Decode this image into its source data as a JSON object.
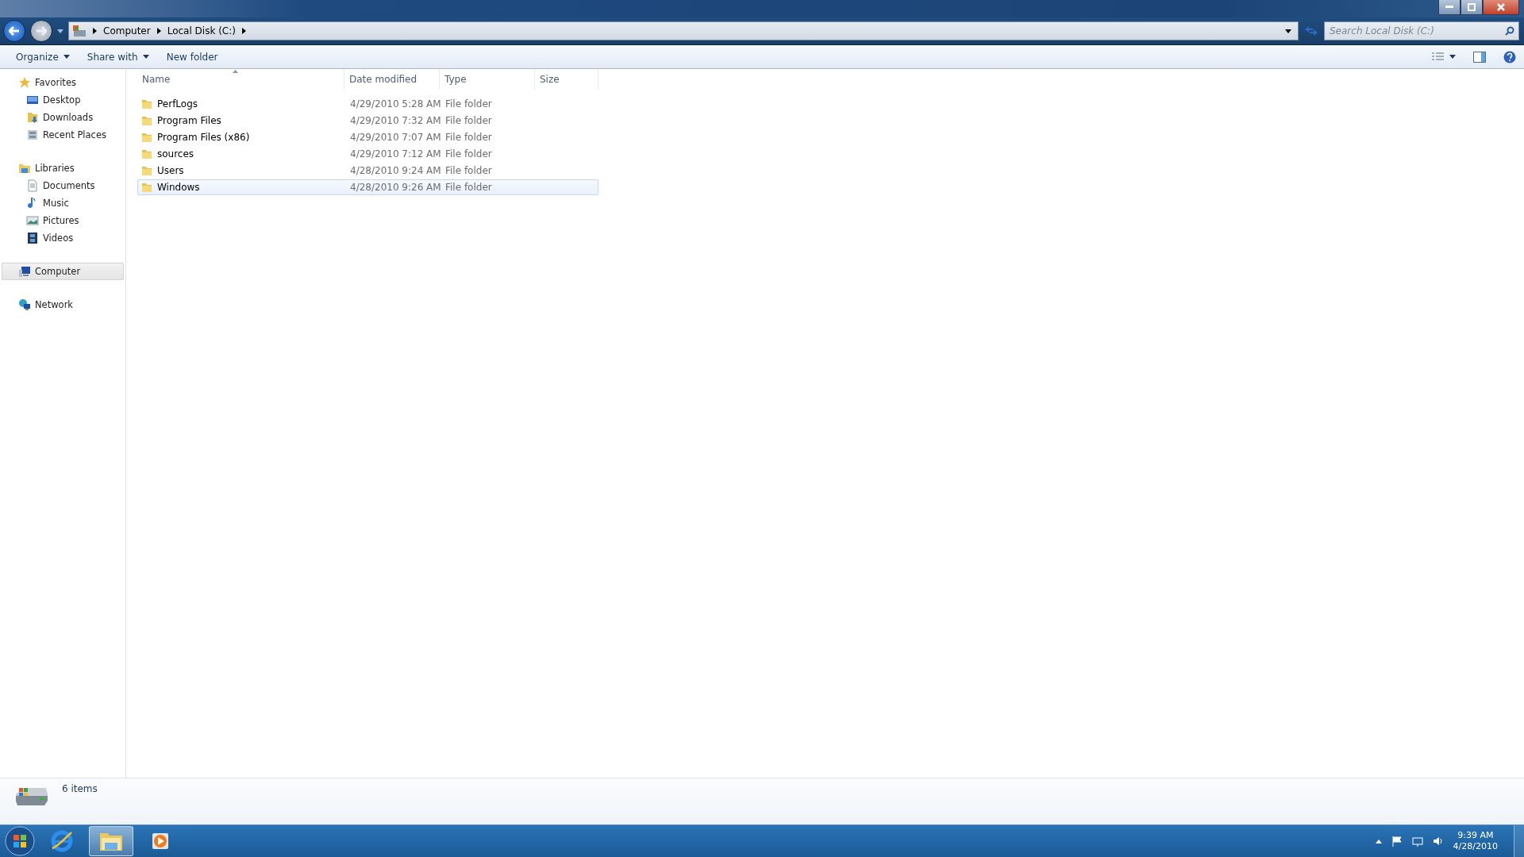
{
  "address_bar": {
    "breadcrumbs": [
      "Computer",
      "Local Disk (C:)"
    ]
  },
  "search": {
    "placeholder": "Search Local Disk (C:)"
  },
  "toolbar": {
    "buttons": [
      {
        "label": "Organize",
        "dropdown": true
      },
      {
        "label": "Share with",
        "dropdown": true
      },
      {
        "label": "New folder",
        "dropdown": false
      }
    ]
  },
  "sidebar": {
    "items": [
      {
        "label": "Favorites",
        "kind": "star",
        "selected": false,
        "children": [
          {
            "label": "Desktop",
            "kind": "desktop",
            "selected": false
          },
          {
            "label": "Downloads",
            "kind": "downloads",
            "selected": false
          },
          {
            "label": "Recent Places",
            "kind": "recent",
            "selected": false
          }
        ]
      },
      {
        "label": "Libraries",
        "kind": "library",
        "selected": false,
        "children": [
          {
            "label": "Documents",
            "kind": "document",
            "selected": false
          },
          {
            "label": "Music",
            "kind": "music",
            "selected": false
          },
          {
            "label": "Pictures",
            "kind": "pictures",
            "selected": false
          },
          {
            "label": "Videos",
            "kind": "video",
            "selected": false
          }
        ]
      },
      {
        "label": "Computer",
        "kind": "computer",
        "selected": true
      },
      {
        "label": "Network",
        "kind": "network",
        "selected": false
      }
    ]
  },
  "table": {
    "columns": [
      {
        "label": "Name",
        "sorted": true
      },
      {
        "label": "Date modified",
        "sorted": false
      },
      {
        "label": "Type",
        "sorted": false
      },
      {
        "label": "Size",
        "sorted": false
      }
    ],
    "rows": [
      {
        "name": "PerfLogs",
        "date": "4/29/2010 5:28 AM",
        "type": "File folder",
        "selected": false
      },
      {
        "name": "Program Files",
        "date": "4/29/2010 7:32 AM",
        "type": "File folder",
        "selected": false
      },
      {
        "name": "Program Files (x86)",
        "date": "4/29/2010 7:07 AM",
        "type": "File folder",
        "selected": false
      },
      {
        "name": "sources",
        "date": "4/29/2010 7:12 AM",
        "type": "File folder",
        "selected": false
      },
      {
        "name": "Users",
        "date": "4/28/2010 9:24 AM",
        "type": "File folder",
        "selected": false
      },
      {
        "name": "Windows",
        "date": "4/28/2010 9:26 AM",
        "type": "File folder",
        "selected": true
      }
    ]
  },
  "status_bar": {
    "text": "6 items"
  },
  "taskbar": {
    "apps": [
      {
        "kind": "browser",
        "active": false
      },
      {
        "kind": "explorer",
        "active": true
      },
      {
        "kind": "media",
        "active": false
      }
    ],
    "time": "9:39 AM",
    "date": "4/28/2010"
  }
}
